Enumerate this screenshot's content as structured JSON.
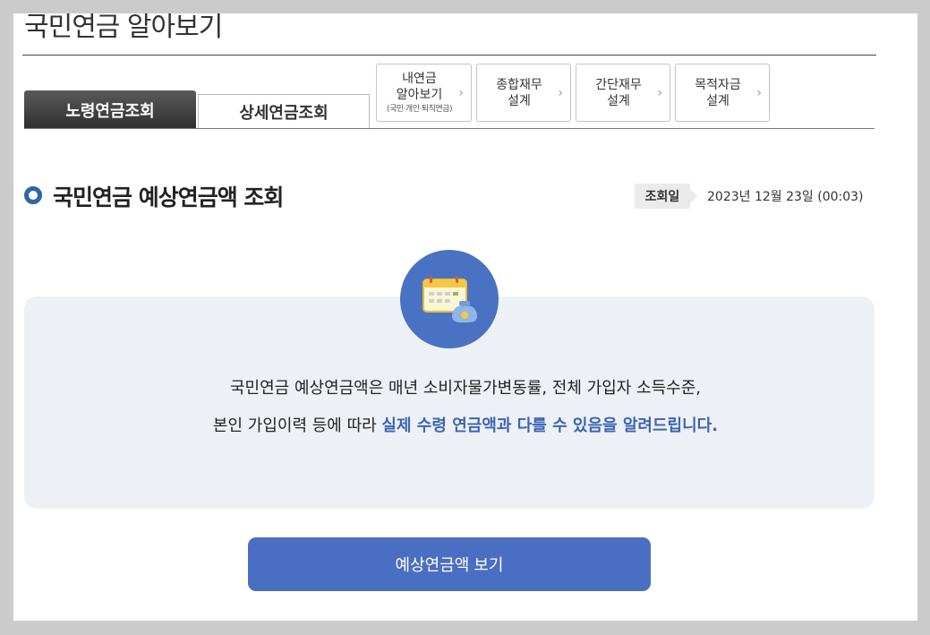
{
  "page": {
    "title": "국민연금 알아보기"
  },
  "tabs": [
    {
      "label": "노령연금조회"
    },
    {
      "label": "상세연금조회"
    }
  ],
  "subtabs": [
    {
      "line1": "내연금",
      "line2": "알아보기",
      "small": "(국민·개인·퇴직연금)"
    },
    {
      "line1": "종합재무",
      "line2": "설계"
    },
    {
      "line1": "간단재무",
      "line2": "설계"
    },
    {
      "line1": "목적자금",
      "line2": "설계"
    }
  ],
  "section": {
    "title": "국민연금 예상연금액 조회",
    "date_label": "조회일",
    "date_value": "2023년 12월 23일 (00:03)"
  },
  "info": {
    "icon": "calendar-money-icon",
    "line1": "국민연금 예상연금액은 매년 소비자물가변동률, 전체 가입자 소득수준,",
    "line2_plain": "본인 가입이력 등에 따라 ",
    "line2_highlight": "실제 수령 연금액과 다를 수 있음을 알려드립니다."
  },
  "button": {
    "label": "예상연금액 보기"
  },
  "colors": {
    "accent": "#4a6ec2",
    "highlight": "#3a64b5",
    "bullet": "#2f65ae",
    "box_bg": "#edf1f5"
  }
}
